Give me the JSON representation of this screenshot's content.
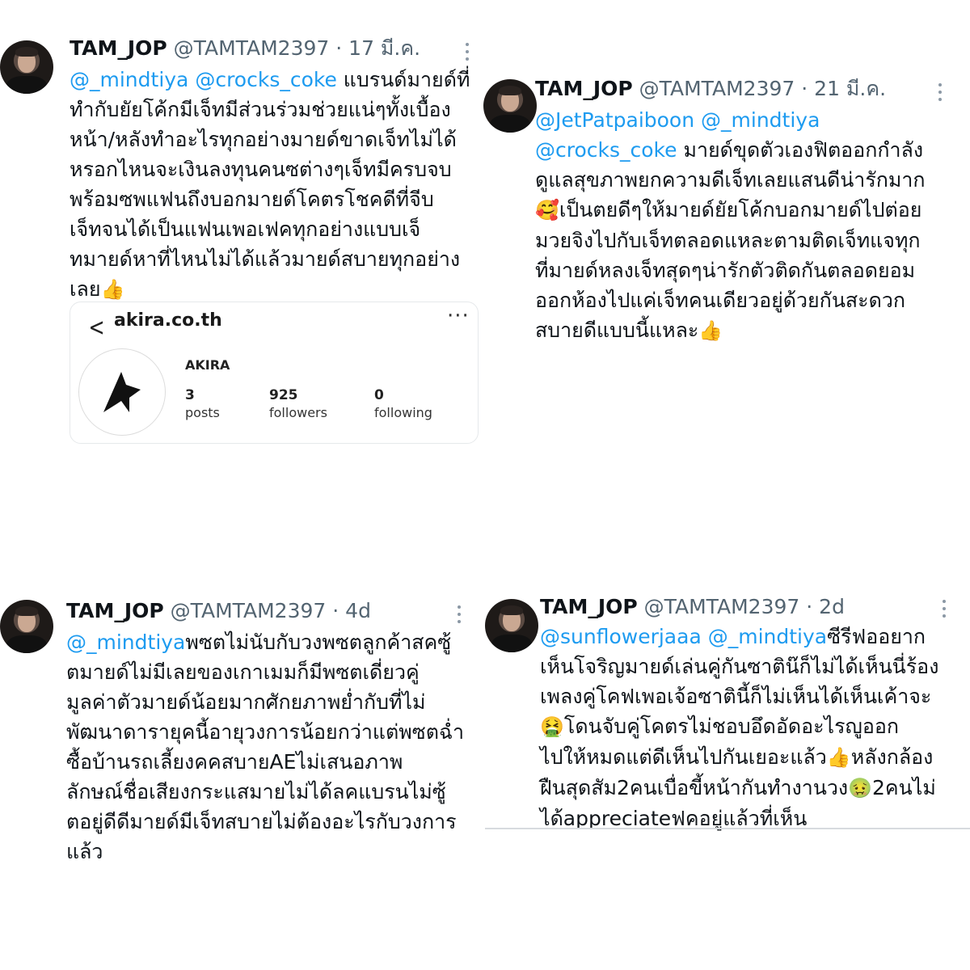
{
  "tweets": [
    {
      "name": "TAM_JOP",
      "handle": "@TAMTAM2397",
      "dot": "·",
      "time": "17 มี.ค.",
      "lines": [
        [
          {
            "t": "@_mindtiya @crocks_coke",
            "m": true
          },
          {
            "t": " แบรนด์มายด์ที่"
          }
        ],
        [
          {
            "t": "ทำกับยัยโค้กมีเจ็ทมีส่วนร่วมช่วยแน่ๆทั้งเบื้อง"
          }
        ],
        [
          {
            "t": "หน้า/หลังทำอะไรทุกอย่างมายด์ขาดเจ็ทไม่ได้"
          }
        ],
        [
          {
            "t": "หรอกไหนจะเงินลงทุนคนซต่างๆเจ็ทมีครบจบ"
          }
        ],
        [
          {
            "t": "พร้อมซพแฟนถึงบอกมายด์โคตรโชคดีที่จีบ"
          }
        ],
        [
          {
            "t": "เจ็ทจนได้เป็นแฟนเพอเฟคทุกอย่างแบบเจ็"
          }
        ],
        [
          {
            "t": "ทมายด์หาที่ไหนไม่ได้แล้วมายด์สบายทุกอย่าง"
          }
        ],
        [
          {
            "t": "เลย"
          },
          {
            "t": "👍",
            "e": true
          }
        ]
      ]
    },
    {
      "name": "TAM_JOP",
      "handle": "@TAMTAM2397",
      "dot": "·",
      "time": "21 มี.ค.",
      "lines": [
        [
          {
            "t": "@JetPatpaiboon @_mindtiya",
            "m": true
          }
        ],
        [
          {
            "t": "@crocks_coke",
            "m": true
          },
          {
            "t": " มายด์ขุดตัวเองฟิตออกกำลัง"
          }
        ],
        [
          {
            "t": "ดูแลสุขภาพยกความดีเจ็ทเลยแสนดีน่ารักมาก"
          }
        ],
        [
          {
            "t": "🥰",
            "e": true
          },
          {
            "t": "เป็นตยดีๆให้มายด์ยัยโค้กบอกมายด์ไปต่อย"
          }
        ],
        [
          {
            "t": "มวยจิงไปกับเจ็ทตลอดแหละตามติดเจ็ทแจทุก"
          }
        ],
        [
          {
            "t": "ที่มายด์หลงเจ็ทสุดๆน่ารักตัวติดกันตลอดยอม"
          }
        ],
        [
          {
            "t": "ออกห้องไปแค่เจ็ทคนเดียวอยู่ด้วยกันสะดวก"
          }
        ],
        [
          {
            "t": "สบายดีแบบนี้แหละ"
          },
          {
            "t": "👍",
            "e": true
          }
        ]
      ]
    },
    {
      "name": "TAM_JOP",
      "handle": "@TAMTAM2397",
      "dot": "·",
      "time": "4d",
      "lines": [
        [
          {
            "t": "@_mindtiya",
            "m": true
          },
          {
            "t": "พซตไม่นับกับวงพซตลูกค้าสคซู้"
          }
        ],
        [
          {
            "t": "ตมายด์ไม่มีเลยของเกาเมมก็มีพซตเดี่ยวคู่"
          }
        ],
        [
          {
            "t": "มูลค่าตัวมายด์น้อยมากศักยภาพย่ำกับที่ไม่"
          }
        ],
        [
          {
            "t": "พัฒนาดารายุคนี้อายุวงการน้อยกว่าแต่พซตฉ่ำ"
          }
        ],
        [
          {
            "t": "ซื้อบ้านรถเลี้ยงคคสบายAEไม่เสนอภาพ"
          }
        ],
        [
          {
            "t": "ลักษณ์ชื่อเสียงกระแสมายไม่ได้ลคแบรนไม่ซู้"
          }
        ],
        [
          {
            "t": "ตอยู่ดีดีมายด์มีเจ็ทสบายไม่ต้องอะไรกับวงการ"
          }
        ],
        [
          {
            "t": "แล้ว"
          }
        ]
      ]
    },
    {
      "name": "TAM_JOP",
      "handle": "@TAMTAM2397",
      "dot": "·",
      "time": "2d",
      "lines": [
        [
          {
            "t": "@sunflowerjaaa @_mindtiya",
            "m": true
          },
          {
            "t": "ซีรีฟออยาก"
          }
        ],
        [
          {
            "t": "เห็นโจริญมายด์เล่นคู่กันซาติน๊ก็ไม่ได้เห็นนี่ร้อง"
          }
        ],
        [
          {
            "t": "เพลงคู่โคฟเพอเจ้อซาตินี้ก็ไม่เห็นได้เห็นเค้าจะ"
          }
        ],
        [
          {
            "t": "🤮",
            "e": true
          },
          {
            "t": "โดนจับคู่โคตรไม่ชอบอึดอัดอะไรญูออก"
          }
        ],
        [
          {
            "t": "ไปให้หมดแต่ดีเห็นไปกันเยอะแล้ว"
          },
          {
            "t": "👍",
            "e": true
          },
          {
            "t": "หลังกล้อง"
          }
        ],
        [
          {
            "t": "ฝืนสุดสัม2คนเบื่อขี้หน้ากันทำงานวง"
          },
          {
            "t": "🤢",
            "e": true
          },
          {
            "t": "2คนไม่"
          }
        ],
        [
          {
            "t": "ได้appreciateฟคอยู่แล้วที่เห็น"
          }
        ]
      ]
    }
  ],
  "card": {
    "site": "akira.co.th",
    "brand": "AKIRA",
    "stats": [
      {
        "num": "3",
        "label": "posts"
      },
      {
        "num": "925",
        "label": "followers"
      },
      {
        "num": "0",
        "label": "following"
      }
    ],
    "back_icon": "chevron-left-icon",
    "more_icon": "more-horizontal-icon"
  },
  "colors": {
    "mention": "#1d9bf0",
    "secondary": "#536471"
  }
}
